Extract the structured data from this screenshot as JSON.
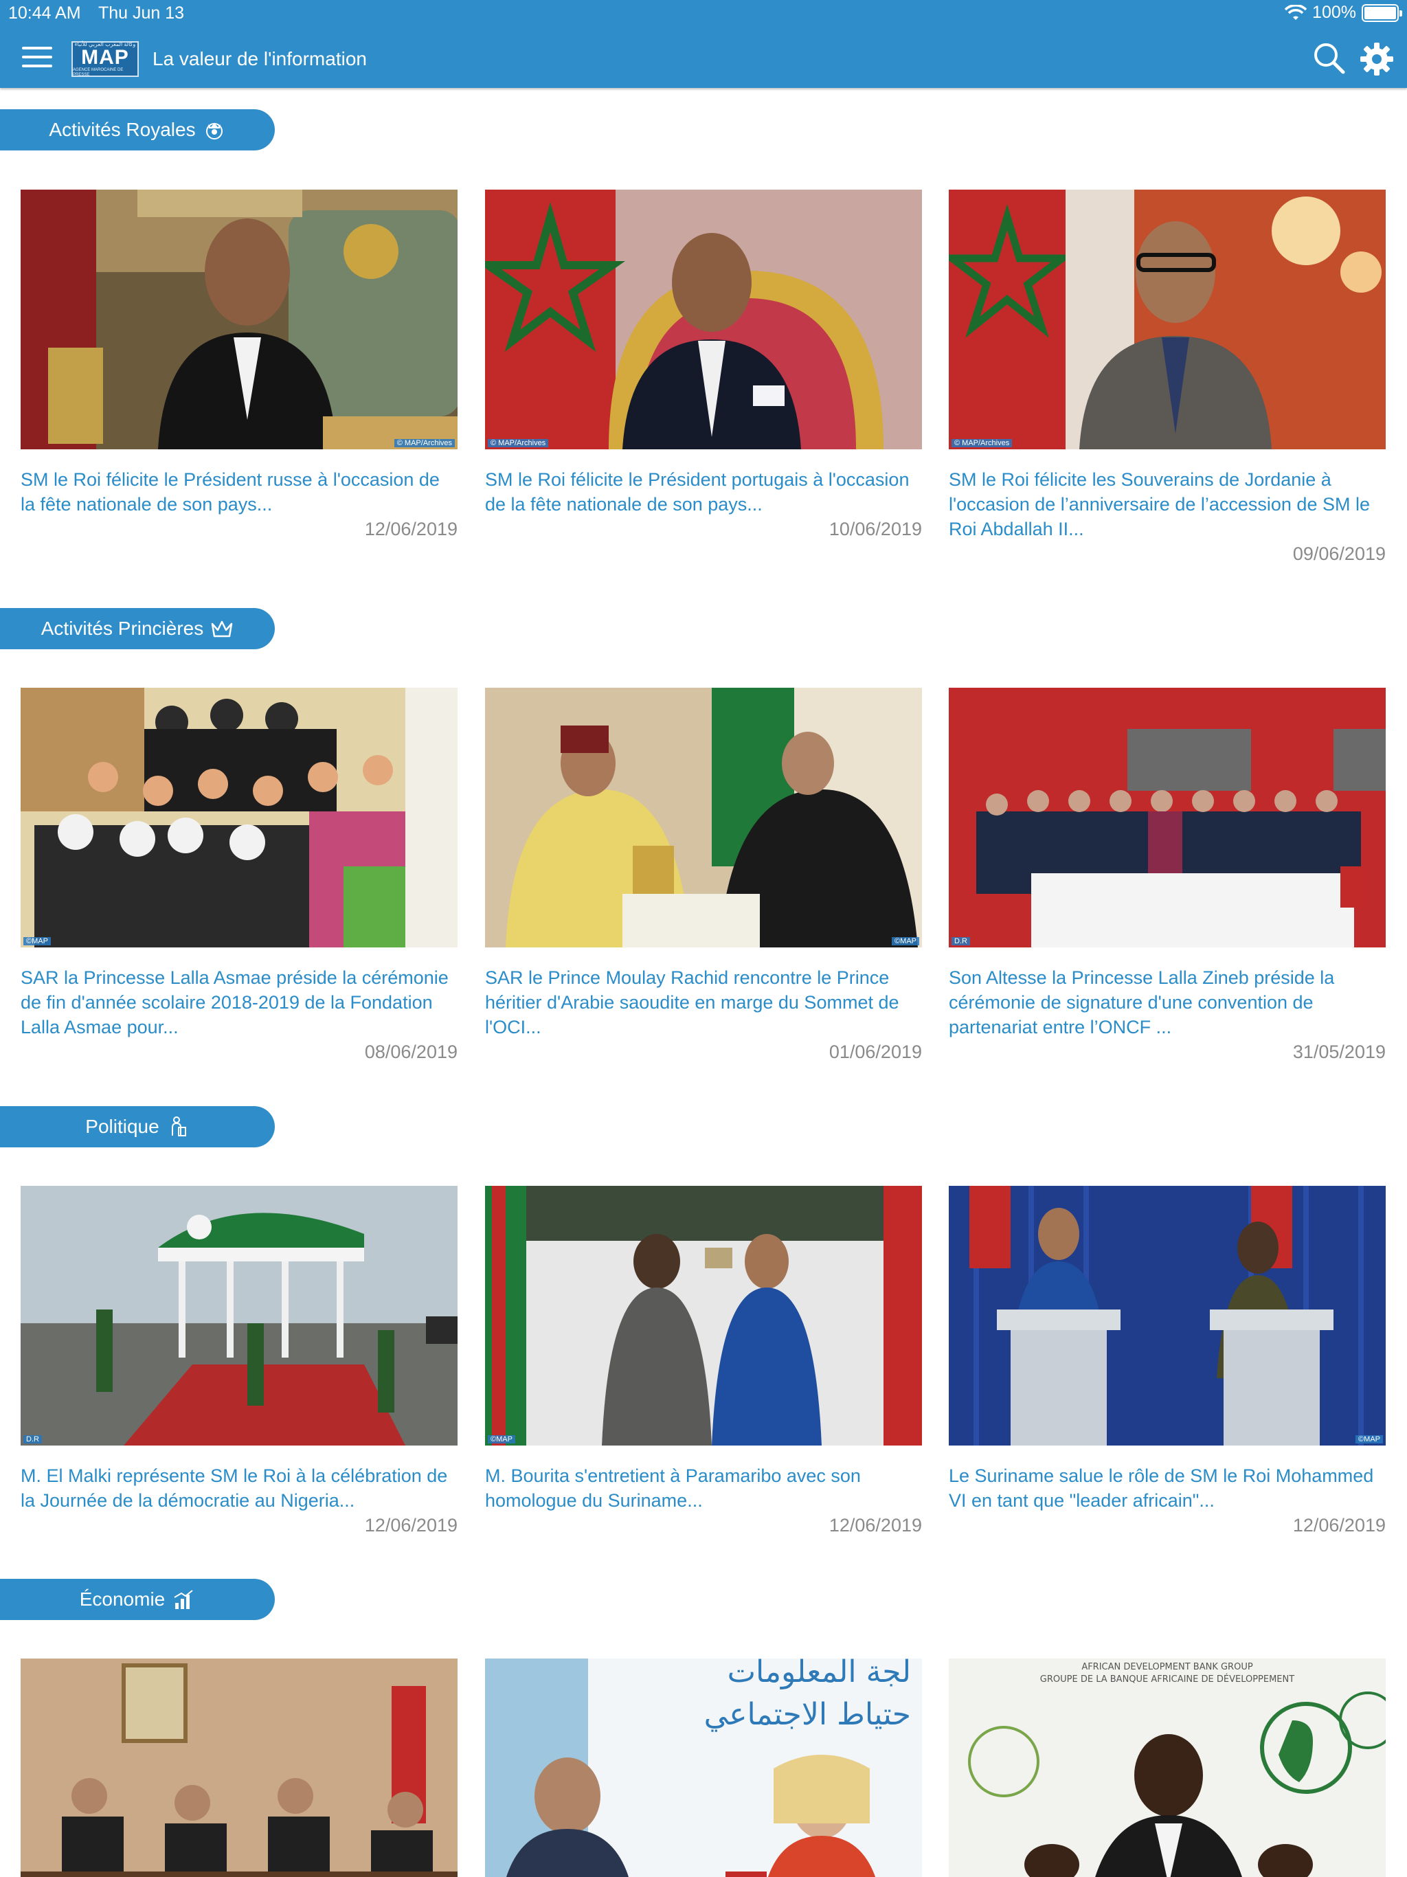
{
  "status": {
    "time": "10:44 AM",
    "date": "Thu Jun 13",
    "battery": "100%"
  },
  "header": {
    "logo_top": "وكالة المغرب العربي للأنباء",
    "logo_word": "MAP",
    "logo_bottom": "AGENCE MAROCAINE DE PRESSE",
    "tagline": "La valeur de l'information"
  },
  "colors": {
    "brand": "#2f8ec9",
    "link": "#2a8cc8",
    "date": "#8a8a8a"
  },
  "sections": [
    {
      "label": "Activités Royales",
      "icon": "royal-emblem-icon",
      "articles": [
        {
          "title": "SM le Roi félicite le Président russe à l'occasion de la fête nationale de son pays...",
          "date": "12/06/2019",
          "credit": "© MAP/Archives"
        },
        {
          "title": "SM le Roi félicite le Président portugais à l'occasion de la fête nationale de son pays...",
          "date": "10/06/2019",
          "credit": "© MAP/Archives"
        },
        {
          "title": "SM le Roi félicite les Souverains de Jordanie à l'occasion de l’anniversaire de l’accession de SM le Roi Abdallah II...",
          "date": "09/06/2019",
          "credit": "© MAP/Archives"
        }
      ]
    },
    {
      "label": "Activités Princières",
      "icon": "crown-icon",
      "articles": [
        {
          "title": "SAR la Princesse Lalla Asmae préside la cérémonie de fin d'année scolaire 2018-2019 de la Fondation Lalla Asmae pour...",
          "date": "08/06/2019",
          "credit": "©MAP"
        },
        {
          "title": "SAR le Prince Moulay Rachid rencontre le Prince héritier d'Arabie saoudite en marge du Sommet de l'OCI...",
          "date": "01/06/2019",
          "credit": "©MAP"
        },
        {
          "title": "Son Altesse la Princesse Lalla Zineb préside la cérémonie de signature d'une convention de partenariat entre l’ONCF ...",
          "date": "31/05/2019",
          "credit": "D.R"
        }
      ]
    },
    {
      "label": "Politique",
      "icon": "politics-icon",
      "articles": [
        {
          "title": "M. El Malki représente SM le Roi à la célébration de la Journée de la démocratie au Nigeria...",
          "date": "12/06/2019",
          "credit": "D.R"
        },
        {
          "title": "M. Bourita s'entretient à Paramaribo avec son homologue du Suriname...",
          "date": "12/06/2019",
          "credit": "©MAP"
        },
        {
          "title": "Le Suriname salue le rôle de SM le Roi Mohammed VI en tant que \"leader africain\"...",
          "date": "12/06/2019",
          "credit": "©MAP"
        }
      ]
    },
    {
      "label": "Économie",
      "icon": "economy-chart-icon",
      "articles": [
        {
          "photo": "meeting-photo"
        },
        {
          "photo": "conference-photo",
          "sign_text": "لجة المعلومات\nحتياط الاجتماعي"
        },
        {
          "photo": "speaker-photo",
          "sign_text_1": "AFRICAN DEVELOPMENT BANK GROUP",
          "sign_text_2": "GROUPE DE LA BANQUE AFRICAINE DE DÉVELOPPEMENT"
        }
      ]
    }
  ]
}
